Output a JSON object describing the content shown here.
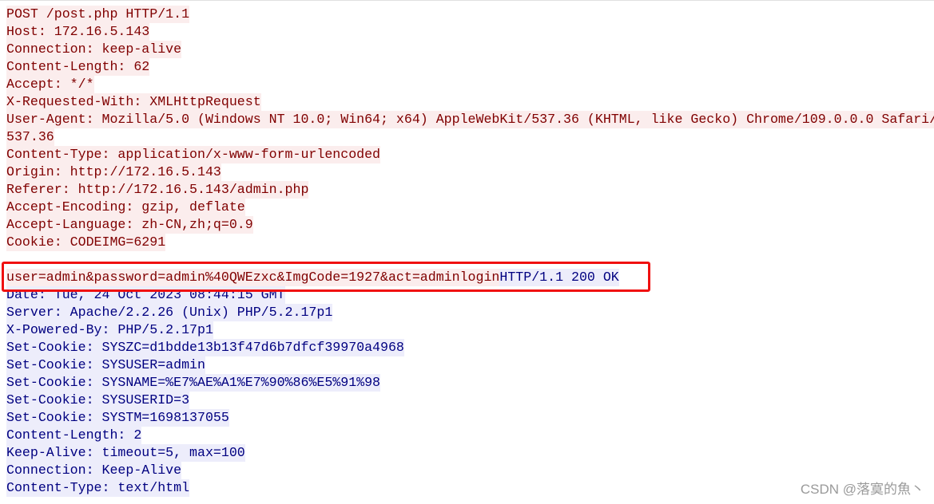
{
  "colors": {
    "request_text": "#800000",
    "request_bg": "#fbeded",
    "response_text": "#000080",
    "response_bg": "#ededfb",
    "highlight_box": "#f01010"
  },
  "lines": [
    [
      {
        "t": "POST /post.php HTTP/1.1",
        "k": "req"
      }
    ],
    [
      {
        "t": "Host: 172.16.5.143",
        "k": "req"
      }
    ],
    [
      {
        "t": "Connection: keep-alive",
        "k": "req"
      }
    ],
    [
      {
        "t": "Content-Length: 62",
        "k": "req"
      }
    ],
    [
      {
        "t": "Accept: */*",
        "k": "req"
      }
    ],
    [
      {
        "t": "X-Requested-With: XMLHttpRequest",
        "k": "req"
      }
    ],
    [
      {
        "t": "User-Agent: Mozilla/5.0 (Windows NT 10.0; Win64; x64) AppleWebKit/537.36 (KHTML, like Gecko) Chrome/109.0.0.0 Safari/",
        "k": "req"
      }
    ],
    [
      {
        "t": "537.36",
        "k": "req"
      }
    ],
    [
      {
        "t": "Content-Type: application/x-www-form-urlencoded",
        "k": "req"
      }
    ],
    [
      {
        "t": "Origin: http://172.16.5.143",
        "k": "req"
      }
    ],
    [
      {
        "t": "Referer: http://172.16.5.143/admin.php",
        "k": "req"
      }
    ],
    [
      {
        "t": "Accept-Encoding: gzip, deflate",
        "k": "req"
      }
    ],
    [
      {
        "t": "Accept-Language: zh-CN,zh;q=0.9",
        "k": "req"
      }
    ],
    [
      {
        "t": "Cookie: CODEIMG=6291",
        "k": "req"
      }
    ],
    [],
    [
      {
        "t": "user=admin&password=admin%40QWEzxc&ImgCode=1927&act=adminlogin",
        "k": "req"
      },
      {
        "t": "HTTP/1.1 200 OK",
        "k": "resp"
      }
    ],
    [
      {
        "t": "Date: Tue, 24 Oct 2023 08:44:15 GMT",
        "k": "resp"
      }
    ],
    [
      {
        "t": "Server: Apache/2.2.26 (Unix) PHP/5.2.17p1",
        "k": "resp"
      }
    ],
    [
      {
        "t": "X-Powered-By: PHP/5.2.17p1",
        "k": "resp"
      }
    ],
    [
      {
        "t": "Set-Cookie: SYSZC=d1bdde13b13f47d6b7dfcf39970a4968",
        "k": "resp"
      }
    ],
    [
      {
        "t": "Set-Cookie: SYSUSER=admin",
        "k": "resp"
      }
    ],
    [
      {
        "t": "Set-Cookie: SYSNAME=%E7%AE%A1%E7%90%86%E5%91%98",
        "k": "resp"
      }
    ],
    [
      {
        "t": "Set-Cookie: SYSUSERID=3",
        "k": "resp"
      }
    ],
    [
      {
        "t": "Set-Cookie: SYSTM=1698137055",
        "k": "resp"
      }
    ],
    [
      {
        "t": "Content-Length: 2",
        "k": "resp"
      }
    ],
    [
      {
        "t": "Keep-Alive: timeout=5, max=100",
        "k": "resp"
      }
    ],
    [
      {
        "t": "Connection: Keep-Alive",
        "k": "resp"
      }
    ],
    [
      {
        "t": "Content-Type: text/html",
        "k": "resp"
      }
    ]
  ],
  "watermark": "CSDN @落寞的魚丶"
}
